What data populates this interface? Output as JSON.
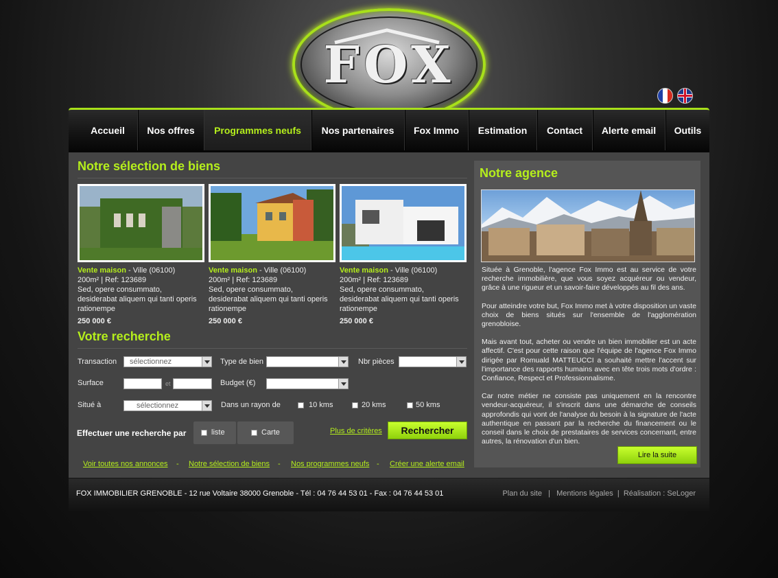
{
  "logo": {
    "text": "FOX"
  },
  "flags": [
    {
      "name": "french-flag"
    },
    {
      "name": "english-flag"
    }
  ],
  "nav": {
    "items": [
      {
        "label": "Accueil"
      },
      {
        "label": "Nos offres"
      },
      {
        "label": "Programmes neufs",
        "active": true
      },
      {
        "label": "Nos partenaires"
      },
      {
        "label": "Fox Immo"
      },
      {
        "label": "Estimation"
      },
      {
        "label": "Contact"
      },
      {
        "label": "Alerte email"
      },
      {
        "label": "Outils"
      }
    ]
  },
  "selection": {
    "title": "Notre sélection de biens",
    "listings": [
      {
        "type": "Vente maison",
        "city": " - Ville (06100)",
        "specs": "200m² | Ref: 123689",
        "desc": "Sed, opere consummato, desiderabat aliquem qui tanti operis rationempe",
        "price": "250 000 €"
      },
      {
        "type": "Vente maison",
        "city": " - Ville (06100)",
        "specs": "200m² | Ref: 123689",
        "desc": "Sed, opere consummato, desiderabat aliquem qui tanti operis rationempe",
        "price": "250 000 €"
      },
      {
        "type": "Vente maison",
        "city": " - Ville (06100)",
        "specs": "200m² | Ref: 123689",
        "desc": "Sed, opere consummato, desiderabat aliquem qui tanti operis rationempe",
        "price": "250 000 €"
      }
    ]
  },
  "search": {
    "title": "Votre recherche",
    "transaction_label": "Transaction",
    "transaction_value": "sélectionnez",
    "type_label": "Type de bien",
    "type_value": "",
    "rooms_label": "Nbr pièces",
    "rooms_value": "",
    "surface_label": "Surface",
    "surface_and": "et",
    "budget_label": "Budget (€)",
    "budget_value": "",
    "location_label": "Situé à",
    "location_value": "sélectionnez",
    "radius_label": "Dans un rayon de",
    "radius_options": [
      "10 kms",
      "20 kms",
      "50 kms"
    ],
    "mode_label": "Effectuer une recherche par",
    "mode_list": "liste",
    "mode_map": "Carte",
    "more_criteria": "Plus de critères",
    "submit": "Rechercher"
  },
  "bottom_links": {
    "all_ads": "Voir toutes nos annonces",
    "selection": "Notre sélection de biens",
    "programs": "Nos programmes neufs",
    "alert": "Créer une alerte email",
    "separator": "-"
  },
  "agency": {
    "title": "Notre agence",
    "paragraphs": [
      "Située à Grenoble, l'agence Fox Immo est au service de votre recherche immobilière, que vous soyez acquéreur ou vendeur, grâce à une rigueur et un savoir-faire développés au fil des ans.",
      "Pour atteindre votre but, Fox Immo met à votre disposition un vaste choix de biens situés sur l'ensemble de l'agglomération grenobloise.",
      "Mais avant tout, acheter ou vendre un bien immobilier est un acte affectif. C'est pour cette raison que l'équipe de l'agence Fox Immo dirigée par Romuald MATTEUCCI a souhaité mettre l'accent sur l'importance des rapports humains avec en tête trois mots d'ordre : Confiance, Respect et Professionnalisme.",
      "Car notre métier ne consiste pas uniquement en la rencontre vendeur-acquéreur, il s'inscrit dans une démarche de conseils approfondis qui vont de l'analyse du besoin à la signature de l'acte authentique en passant par la recherche du financement ou le conseil dans le choix de prestataires de services concernant, entre autres, la rénovation d'un bien."
    ],
    "read_more": "Lire la suite"
  },
  "footer": {
    "address": "FOX IMMOBILIER GRENOBLE - 12 rue Voltaire 38000 Grenoble - Tél : 04 76 44 53 01 - Fax : 04 76 44 53 01",
    "sitemap": "Plan du site",
    "legal": "Mentions légales",
    "credit": "Réalisation : SeLoger",
    "separator": "|"
  },
  "colors": {
    "accent": "#b5ef1c",
    "panel": "#444444",
    "panel_right": "#555555"
  }
}
